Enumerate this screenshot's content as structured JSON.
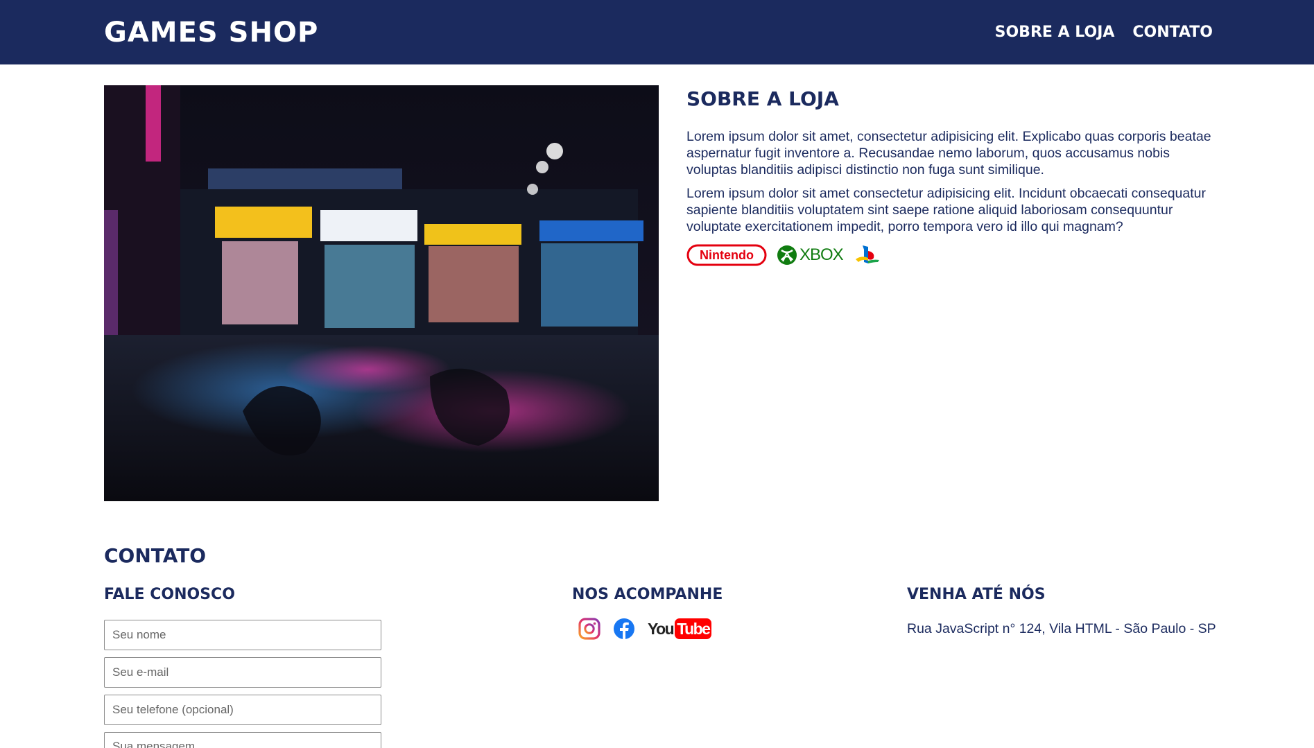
{
  "header": {
    "logo": "GAMES SHOP",
    "nav": [
      "SOBRE A LOJA",
      "CONTATO"
    ]
  },
  "about": {
    "title": "SOBRE A LOJA",
    "paragraphs": [
      "Lorem ipsum dolor sit amet, consectetur adipisicing elit. Explicabo quas corporis beatae aspernatur fugit inventore a. Recusandae nemo laborum, quos accusamus nobis voluptas blanditiis adipisci distinctio non fuga sunt similique.",
      "Lorem ipsum dolor sit amet consectetur adipisicing elit. Incidunt obcaecati consequatur sapiente blanditiis voluptatem sint saepe ratione aliquid laboriosam consequuntur voluptate exercitationem impedit, porro tempora vero id illo qui magnam?"
    ],
    "brands": {
      "nintendo": "Nintendo",
      "xbox": "XBOX",
      "playstation_icon": "playstation-icon"
    }
  },
  "contact": {
    "title": "CONTATO",
    "form": {
      "title": "FALE CONOSCO",
      "name_placeholder": "Seu nome",
      "email_placeholder": "Seu e-mail",
      "phone_placeholder": "Seu telefone (opcional)",
      "message_placeholder": "Sua mensagem"
    },
    "follow": {
      "title": "NOS ACOMPANHE",
      "youtube_you": "You",
      "youtube_tube": "Tube"
    },
    "visit": {
      "title": "VENHA ATÉ NÓS",
      "address": "Rua JavaScript n° 124, Vila HTML - São Paulo - SP"
    }
  },
  "colors": {
    "primary": "#1b2a5e",
    "nintendo_red": "#e4000f",
    "xbox_green": "#107c10",
    "youtube_red": "#ff0000",
    "facebook_blue": "#1877f2"
  }
}
